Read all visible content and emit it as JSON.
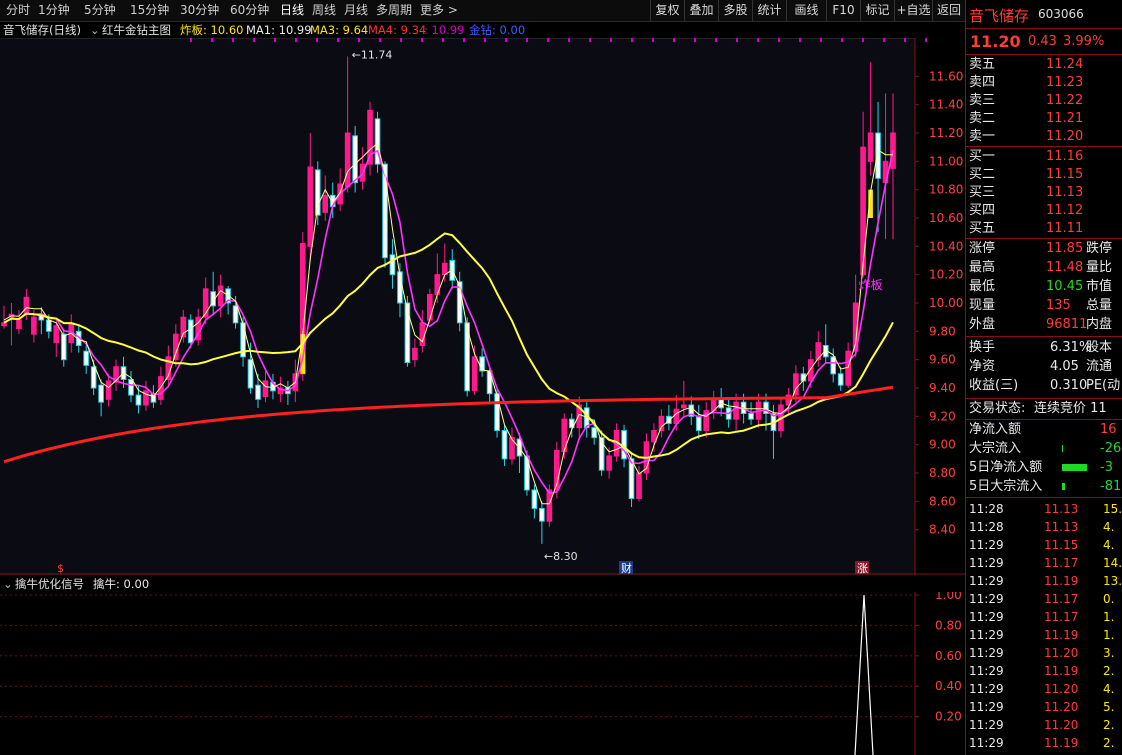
{
  "toolbar": {
    "periods": [
      "分时",
      "1分钟",
      "5分钟",
      "15分钟",
      "30分钟",
      "60分钟",
      "日线",
      "周线",
      "月线",
      "多周期",
      "更多 >"
    ],
    "active": "日线",
    "buttons": [
      "复权",
      "叠加",
      "多股",
      "统计",
      "画线",
      "F10",
      "标记",
      "+自选",
      "返回"
    ]
  },
  "info": {
    "stock": "音飞储存(日线)",
    "indicator": "红牛金钻主图",
    "items": [
      {
        "label": "炸板: 10.60",
        "color": "#ffe600"
      },
      {
        "label": "MA1: 10.99",
        "color": "#e8e8e8"
      },
      {
        "label": "MA3: 9.64",
        "color": "#ffe600"
      },
      {
        "label": "MA4: 9.34",
        "color": "#ff3333"
      },
      {
        "label": ": 10.99",
        "color": "#d000d0"
      },
      {
        "label": "金钻: 0.00",
        "color": "#3a5cff"
      }
    ]
  },
  "chart_data": {
    "type": "candlestick",
    "ylim": [
      8.2,
      11.8
    ],
    "y_ticks": [
      "11.60",
      "11.40",
      "11.20",
      "11.00",
      "10.80",
      "10.60",
      "10.40",
      "10.20",
      "10.00",
      "9.80",
      "9.60",
      "9.40",
      "9.20",
      "9.00",
      "8.80",
      "8.60",
      "8.40"
    ],
    "annotations": {
      "high": "11.74",
      "low": "8.30",
      "zhaban": "炸板"
    },
    "markers": [
      "$",
      "财",
      "涨"
    ],
    "colors": {
      "up": "#ff1a8c",
      "down": "#27d4e8",
      "ma_short": "#ff33ff",
      "ma_yellow": "#ffff40",
      "ma_long": "#ff2020",
      "fill_yellow": "#ffe600"
    },
    "candles": [
      [
        9.84,
        9.86,
        9.98,
        9.82
      ],
      [
        9.9,
        9.92,
        10.0,
        9.7
      ],
      [
        9.82,
        9.88,
        9.95,
        9.78
      ],
      [
        9.92,
        10.04,
        10.1,
        9.88
      ],
      [
        9.78,
        9.9,
        9.95,
        9.72
      ],
      [
        9.92,
        9.88,
        9.97,
        9.78
      ],
      [
        9.88,
        9.8,
        9.92,
        9.75
      ],
      [
        9.72,
        9.84,
        9.88,
        9.62
      ],
      [
        9.78,
        9.6,
        9.82,
        9.55
      ],
      [
        9.72,
        9.86,
        9.92,
        9.65
      ],
      [
        9.8,
        9.7,
        9.85,
        9.65
      ],
      [
        9.66,
        9.56,
        9.7,
        9.5
      ],
      [
        9.55,
        9.4,
        9.6,
        9.35
      ],
      [
        9.42,
        9.3,
        9.46,
        9.2
      ],
      [
        9.32,
        9.45,
        9.5,
        9.27
      ],
      [
        9.44,
        9.55,
        9.6,
        9.38
      ],
      [
        9.55,
        9.46,
        9.62,
        9.4
      ],
      [
        9.46,
        9.35,
        9.52,
        9.3
      ],
      [
        9.35,
        9.28,
        9.42,
        9.22
      ],
      [
        9.28,
        9.38,
        9.45,
        9.24
      ],
      [
        9.36,
        9.3,
        9.42,
        9.26
      ],
      [
        9.32,
        9.48,
        9.55,
        9.28
      ],
      [
        9.46,
        9.62,
        9.7,
        9.42
      ],
      [
        9.6,
        9.78,
        9.85,
        9.55
      ],
      [
        9.76,
        9.9,
        9.95,
        9.72
      ],
      [
        9.88,
        9.72,
        9.92,
        9.68
      ],
      [
        9.74,
        9.9,
        9.96,
        9.7
      ],
      [
        9.9,
        10.1,
        10.18,
        9.85
      ],
      [
        10.08,
        9.98,
        10.22,
        9.92
      ],
      [
        9.98,
        10.12,
        10.2,
        9.9
      ],
      [
        10.1,
        10.0,
        10.12,
        9.92
      ],
      [
        9.98,
        9.86,
        10.05,
        9.82
      ],
      [
        9.86,
        9.62,
        9.9,
        9.55
      ],
      [
        9.6,
        9.4,
        9.72,
        9.36
      ],
      [
        9.42,
        9.32,
        9.5,
        9.26
      ],
      [
        9.34,
        9.45,
        9.52,
        9.3
      ],
      [
        9.44,
        9.38,
        9.5,
        9.32
      ],
      [
        9.36,
        9.4,
        9.48,
        9.3
      ],
      [
        9.4,
        9.36,
        9.45,
        9.28
      ],
      [
        9.38,
        9.5,
        9.6,
        9.3
      ],
      [
        9.5,
        10.42,
        10.5,
        9.45
      ],
      [
        10.4,
        10.96,
        11.2,
        10.3
      ],
      [
        10.94,
        10.62,
        11.0,
        10.55
      ],
      [
        10.64,
        10.76,
        10.9,
        10.58
      ],
      [
        10.76,
        10.68,
        10.85,
        10.6
      ],
      [
        10.7,
        10.84,
        10.95,
        10.65
      ],
      [
        10.82,
        11.2,
        11.74,
        10.78
      ],
      [
        11.18,
        10.85,
        11.25,
        10.78
      ],
      [
        10.86,
        10.98,
        11.1,
        10.8
      ],
      [
        10.98,
        11.36,
        11.42,
        10.9
      ],
      [
        11.3,
        10.98,
        11.35,
        10.92
      ],
      [
        10.98,
        10.32,
        11.0,
        10.25
      ],
      [
        10.34,
        10.2,
        10.45,
        10.1
      ],
      [
        10.22,
        10.0,
        10.28,
        9.9
      ],
      [
        10.0,
        9.58,
        10.05,
        9.55
      ],
      [
        9.6,
        9.68,
        9.75,
        9.55
      ],
      [
        9.7,
        9.86,
        9.95,
        9.65
      ],
      [
        9.88,
        10.06,
        10.1,
        9.85
      ],
      [
        10.06,
        10.2,
        10.35,
        10.0
      ],
      [
        10.2,
        10.28,
        10.42,
        10.15
      ],
      [
        10.3,
        10.16,
        10.38,
        10.1
      ],
      [
        10.15,
        9.86,
        10.22,
        9.8
      ],
      [
        9.86,
        9.38,
        9.9,
        9.34
      ],
      [
        9.38,
        9.62,
        9.7,
        9.35
      ],
      [
        9.62,
        9.52,
        9.68,
        9.48
      ],
      [
        9.52,
        9.36,
        9.56,
        9.3
      ],
      [
        9.36,
        9.1,
        9.4,
        9.05
      ],
      [
        9.1,
        8.9,
        9.14,
        8.85
      ],
      [
        8.9,
        9.05,
        9.12,
        8.86
      ],
      [
        9.04,
        8.92,
        9.08,
        8.8
      ],
      [
        8.92,
        8.68,
        8.96,
        8.64
      ],
      [
        8.68,
        8.55,
        8.72,
        8.48
      ],
      [
        8.55,
        8.46,
        8.6,
        8.3
      ],
      [
        8.46,
        8.68,
        8.72,
        8.42
      ],
      [
        8.68,
        8.96,
        9.02,
        8.62
      ],
      [
        8.95,
        9.18,
        9.22,
        8.9
      ],
      [
        9.18,
        9.12,
        9.22,
        9.05
      ],
      [
        9.12,
        9.28,
        9.34,
        9.05
      ],
      [
        9.26,
        9.12,
        9.3,
        9.05
      ],
      [
        9.12,
        9.05,
        9.18,
        9.0
      ],
      [
        9.05,
        8.82,
        9.1,
        8.78
      ],
      [
        8.82,
        8.92,
        8.98,
        8.76
      ],
      [
        8.92,
        9.1,
        9.15,
        8.88
      ],
      [
        9.1,
        8.9,
        9.14,
        8.84
      ],
      [
        8.9,
        8.62,
        8.95,
        8.56
      ],
      [
        8.62,
        8.8,
        8.85,
        8.6
      ],
      [
        8.8,
        9.02,
        9.08,
        8.75
      ],
      [
        9.02,
        9.1,
        9.15,
        8.95
      ],
      [
        9.1,
        9.2,
        9.25,
        9.05
      ],
      [
        9.2,
        9.15,
        9.28,
        9.1
      ],
      [
        9.15,
        9.25,
        9.35,
        9.1
      ],
      [
        9.26,
        9.28,
        9.45,
        9.2
      ],
      [
        9.28,
        9.2,
        9.34,
        9.14
      ],
      [
        9.2,
        9.1,
        9.28,
        9.04
      ],
      [
        9.1,
        9.24,
        9.3,
        9.05
      ],
      [
        9.24,
        9.32,
        9.38,
        9.18
      ],
      [
        9.32,
        9.26,
        9.4,
        9.2
      ],
      [
        9.26,
        9.18,
        9.32,
        9.12
      ],
      [
        9.18,
        9.3,
        9.36,
        9.1
      ],
      [
        9.3,
        9.22,
        9.36,
        9.15
      ],
      [
        9.22,
        9.18,
        9.3,
        9.14
      ],
      [
        9.18,
        9.3,
        9.36,
        9.12
      ],
      [
        9.3,
        9.22,
        9.36,
        9.1
      ],
      [
        9.22,
        9.1,
        9.28,
        8.9
      ],
      [
        9.1,
        9.28,
        9.32,
        9.05
      ],
      [
        9.28,
        9.35,
        9.4,
        9.22
      ],
      [
        9.35,
        9.5,
        9.56,
        9.3
      ],
      [
        9.5,
        9.45,
        9.55,
        9.38
      ],
      [
        9.45,
        9.6,
        9.66,
        9.4
      ],
      [
        9.6,
        9.72,
        9.8,
        9.55
      ],
      [
        9.7,
        9.62,
        9.85,
        9.58
      ],
      [
        9.62,
        9.5,
        9.68,
        9.44
      ],
      [
        9.5,
        9.42,
        9.55,
        9.38
      ],
      [
        9.42,
        9.66,
        9.72,
        9.4
      ],
      [
        9.66,
        10.0,
        10.2,
        9.62
      ],
      [
        10.2,
        11.1,
        11.35,
        10.18
      ],
      [
        11.0,
        11.2,
        11.7,
        10.9
      ],
      [
        11.2,
        10.88,
        11.42,
        10.5
      ],
      [
        10.85,
        11.0,
        11.48,
        10.45
      ],
      [
        10.95,
        11.2,
        11.48,
        10.45
      ]
    ]
  },
  "sub": {
    "title": "擒牛优化信号",
    "label": "擒牛: 0.00",
    "ticks": [
      "1.00",
      "0.80",
      "0.60",
      "0.40",
      "0.20"
    ]
  },
  "quote": {
    "name": "音飞储存",
    "code": "603066",
    "price": "11.20",
    "change": "0.43",
    "pct": "3.99%",
    "asks": [
      [
        "卖五",
        "11.24"
      ],
      [
        "卖四",
        "11.23"
      ],
      [
        "卖三",
        "11.22"
      ],
      [
        "卖二",
        "11.21"
      ],
      [
        "卖一",
        "11.20"
      ]
    ],
    "bids": [
      [
        "买一",
        "11.16"
      ],
      [
        "买二",
        "11.15"
      ],
      [
        "买三",
        "11.13"
      ],
      [
        "买四",
        "11.12"
      ],
      [
        "买五",
        "11.11"
      ]
    ],
    "stats": [
      [
        "涨停",
        "11.85",
        "跌停"
      ],
      [
        "最高",
        "11.48",
        "量比"
      ],
      [
        "最低",
        "10.45",
        "市值"
      ],
      [
        "现量",
        "135",
        "总量"
      ],
      [
        "外盘",
        "96811",
        "内盘"
      ]
    ],
    "stats2": [
      [
        "换手",
        "6.31%",
        "股本"
      ],
      [
        "净资",
        "4.05",
        "流通"
      ],
      [
        "收益(三)",
        "0.310",
        "PE(动"
      ]
    ],
    "status_label": "交易状态:",
    "status_value": "连续竞价 11",
    "flows": [
      [
        "净流入额",
        "16"
      ],
      [
        "大宗流入",
        "-26"
      ],
      [
        "5日净流入额",
        "-3"
      ],
      [
        "5日大宗流入",
        "-81"
      ]
    ],
    "ticks": [
      [
        "11:28",
        "11.13",
        "15."
      ],
      [
        "11:28",
        "11.13",
        "4."
      ],
      [
        "11:29",
        "11.15",
        "4."
      ],
      [
        "11:29",
        "11.17",
        "14."
      ],
      [
        "11:29",
        "11.19",
        "13."
      ],
      [
        "11:29",
        "11.17",
        "0."
      ],
      [
        "11:29",
        "11.17",
        "1."
      ],
      [
        "11:29",
        "11.19",
        "1."
      ],
      [
        "11:29",
        "11.20",
        "3."
      ],
      [
        "11:29",
        "11.19",
        "2."
      ],
      [
        "11:29",
        "11.20",
        "4."
      ],
      [
        "11:29",
        "11.20",
        "5."
      ],
      [
        "11:29",
        "11.20",
        "2."
      ],
      [
        "11:29",
        "11.19",
        "2."
      ]
    ]
  }
}
